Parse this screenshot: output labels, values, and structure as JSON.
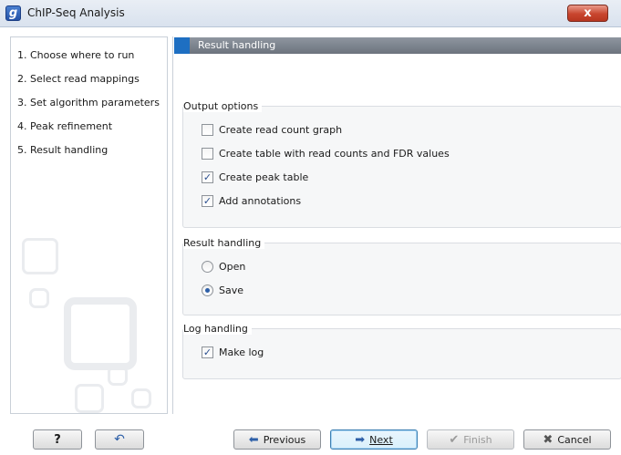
{
  "window": {
    "app_icon": "g",
    "title": "ChIP-Seq Analysis",
    "close_glyph": "x"
  },
  "steps": [
    "1.  Choose where to run",
    "2.  Select read mappings",
    "3.  Set algorithm parameters",
    "4.  Peak refinement",
    "5.  Result handling"
  ],
  "panel": {
    "header": "Result handling",
    "output_options": {
      "title": "Output options",
      "options": [
        {
          "label": "Create read count graph",
          "checked": false
        },
        {
          "label": "Create table with read counts and FDR values",
          "checked": false
        },
        {
          "label": "Create peak table",
          "checked": true
        },
        {
          "label": "Add annotations",
          "checked": true
        }
      ]
    },
    "result_handling": {
      "title": "Result handling",
      "options": [
        {
          "label": "Open",
          "selected": false
        },
        {
          "label": "Save",
          "selected": true
        }
      ]
    },
    "log_handling": {
      "title": "Log handling",
      "options": [
        {
          "label": "Make log",
          "checked": true
        }
      ]
    }
  },
  "buttons": {
    "help": "?",
    "reset_icon": "reset-icon",
    "previous": "Previous",
    "next": "Next",
    "finish": "Finish",
    "cancel": "Cancel"
  },
  "colors": {
    "header_accent": "#1e6fc2",
    "close_button": "#c8452e",
    "check": "#2a4f8f"
  }
}
